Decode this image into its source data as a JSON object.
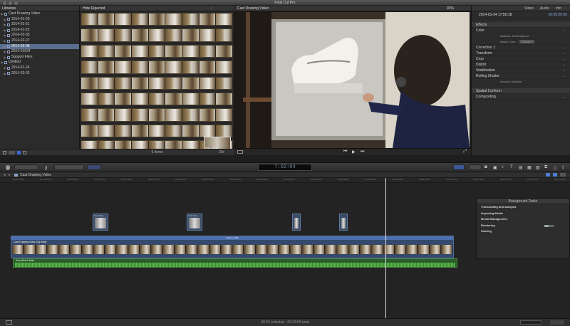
{
  "window": {
    "title": "Final Cut Pro"
  },
  "libraries": {
    "header": "Libraries",
    "items": [
      {
        "label": "Cast Drawing Video",
        "indent": 0,
        "type": "library"
      },
      {
        "label": "2014-01-20",
        "indent": 1
      },
      {
        "label": "2014-01-21",
        "indent": 1
      },
      {
        "label": "2014-01-22",
        "indent": 1
      },
      {
        "label": "2014-02-03",
        "indent": 1
      },
      {
        "label": "2014-02-07",
        "indent": 1
      },
      {
        "label": "2014-02-08",
        "indent": 1,
        "selected": true
      },
      {
        "label": "2014-01024",
        "indent": 1
      },
      {
        "label": "Support Files",
        "indent": 1
      },
      {
        "label": "Untitled",
        "indent": 0,
        "type": "library"
      },
      {
        "label": "2014-01-24",
        "indent": 1
      },
      {
        "label": "2014-02-02",
        "indent": 1
      }
    ]
  },
  "browser": {
    "header": "Hide Rejected",
    "footer": "6 items",
    "zoom": "30s",
    "clip_label": "2014... 20:31"
  },
  "viewer": {
    "title": "Cast Drawing Video",
    "zoom": "92%"
  },
  "inspector": {
    "tabs": [
      "Video",
      "Audio",
      "Info"
    ],
    "date": "2014-01-24 17:50:18",
    "timecode": "00:00:00:00",
    "sections": [
      {
        "label": "Effects",
        "kind": "header"
      },
      {
        "label": "Color",
        "kind": "row"
      },
      {
        "label": "Balance: Not Analyzed",
        "kind": "sub"
      },
      {
        "label": "Match Color:",
        "value": "Choose...",
        "kind": "sub"
      },
      {
        "label": "Correction 1",
        "kind": "row"
      },
      {
        "label": "Transform",
        "kind": "row"
      },
      {
        "label": "Crop",
        "kind": "row"
      },
      {
        "label": "Distort",
        "kind": "row"
      },
      {
        "label": "Stabilization",
        "kind": "row"
      },
      {
        "label": "Rolling Shutter",
        "kind": "row"
      },
      {
        "label": "Amount: Medium",
        "kind": "sub"
      },
      {
        "label": "Spatial Conform",
        "kind": "header"
      },
      {
        "label": "Compositing",
        "kind": "row"
      }
    ]
  },
  "toolbar": {
    "timecode": "7:02:04"
  },
  "timeline": {
    "title": "Cast Drawing Video",
    "ruler": [
      "00:00:00:00",
      "00:00:05:00",
      "00:00:10:00",
      "00:00:15:00",
      "00:00:20:00",
      "00:00:25:00",
      "00:00:30:00",
      "00:00:35:00",
      "00:00:40:00",
      "00:00:45:00",
      "00:00:50:00",
      "00:00:55:00",
      "00:01:00:00",
      "00:01:05:00",
      "00:01:10:00",
      "00:01:15:00",
      "00:01:20:00",
      "00:01:25:00",
      "00:01:30:00",
      "00:01:35:00",
      "00:01:40:00"
    ],
    "connected_label": "Cast Dwg",
    "primary_clip": "Cast Drawing Video Clip Main",
    "storyline_label": "Cast 3-cl Wk",
    "audio_clip": "Soundtrack Main"
  },
  "background_tasks": {
    "header": "Background Tasks",
    "items": [
      "Transcoding and Analysis",
      "Importing Media",
      "Media Management",
      "Rendering",
      "Sharing"
    ],
    "rendering_progress": 0.4
  },
  "status": {
    "text": "00:02 selected - 00:33:05 total"
  }
}
